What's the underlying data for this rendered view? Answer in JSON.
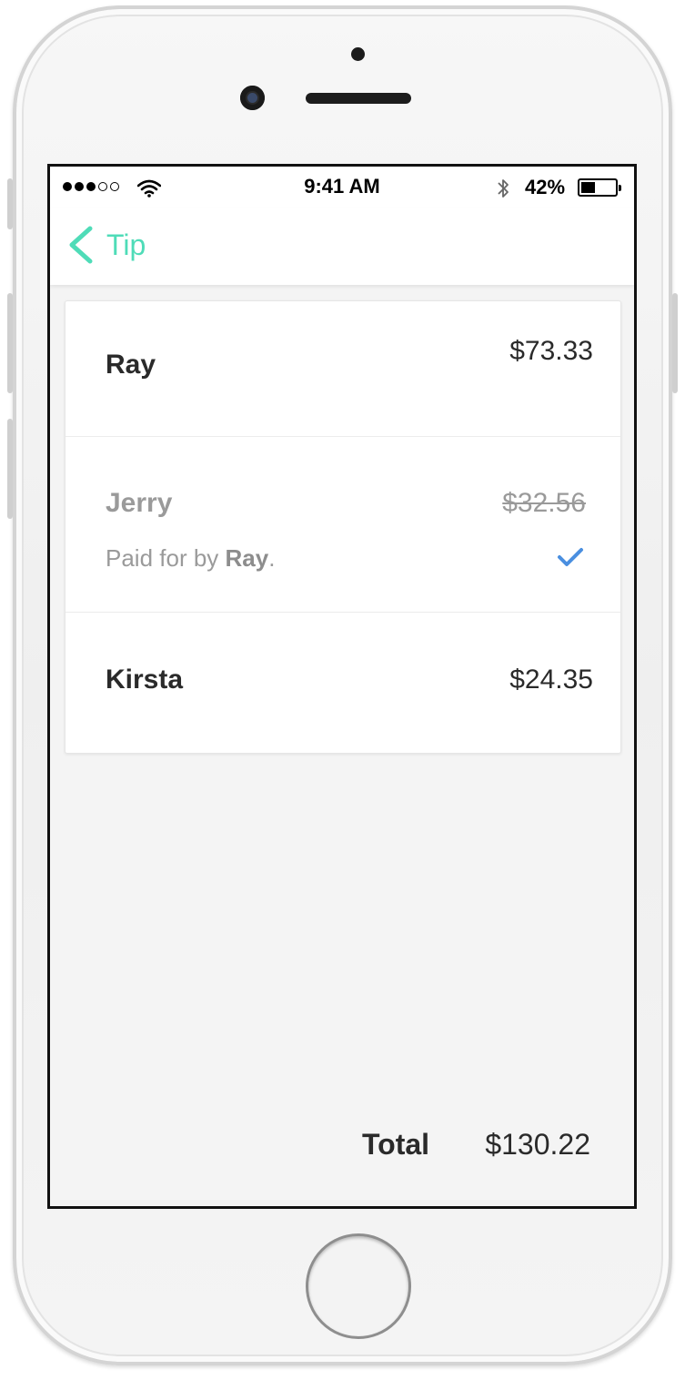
{
  "status_bar": {
    "signal_filled": 3,
    "signal_total": 5,
    "time": "9:41 AM",
    "battery_percent_text": "42%",
    "battery_level": 0.42
  },
  "nav": {
    "back_label": "Tip",
    "accent_color": "#4fdcb8"
  },
  "people": [
    {
      "name": "Ray",
      "amount": "$73.33",
      "paid": false
    },
    {
      "name": "Jerry",
      "amount": "$32.56",
      "paid": true,
      "note_prefix": "Paid for by ",
      "paid_by": "Ray",
      "note_suffix": "."
    },
    {
      "name": "Kirsta",
      "amount": "$24.35",
      "paid": false
    }
  ],
  "check_color": "#4a8fe0",
  "total": {
    "label": "Total",
    "value": "$130.22"
  }
}
